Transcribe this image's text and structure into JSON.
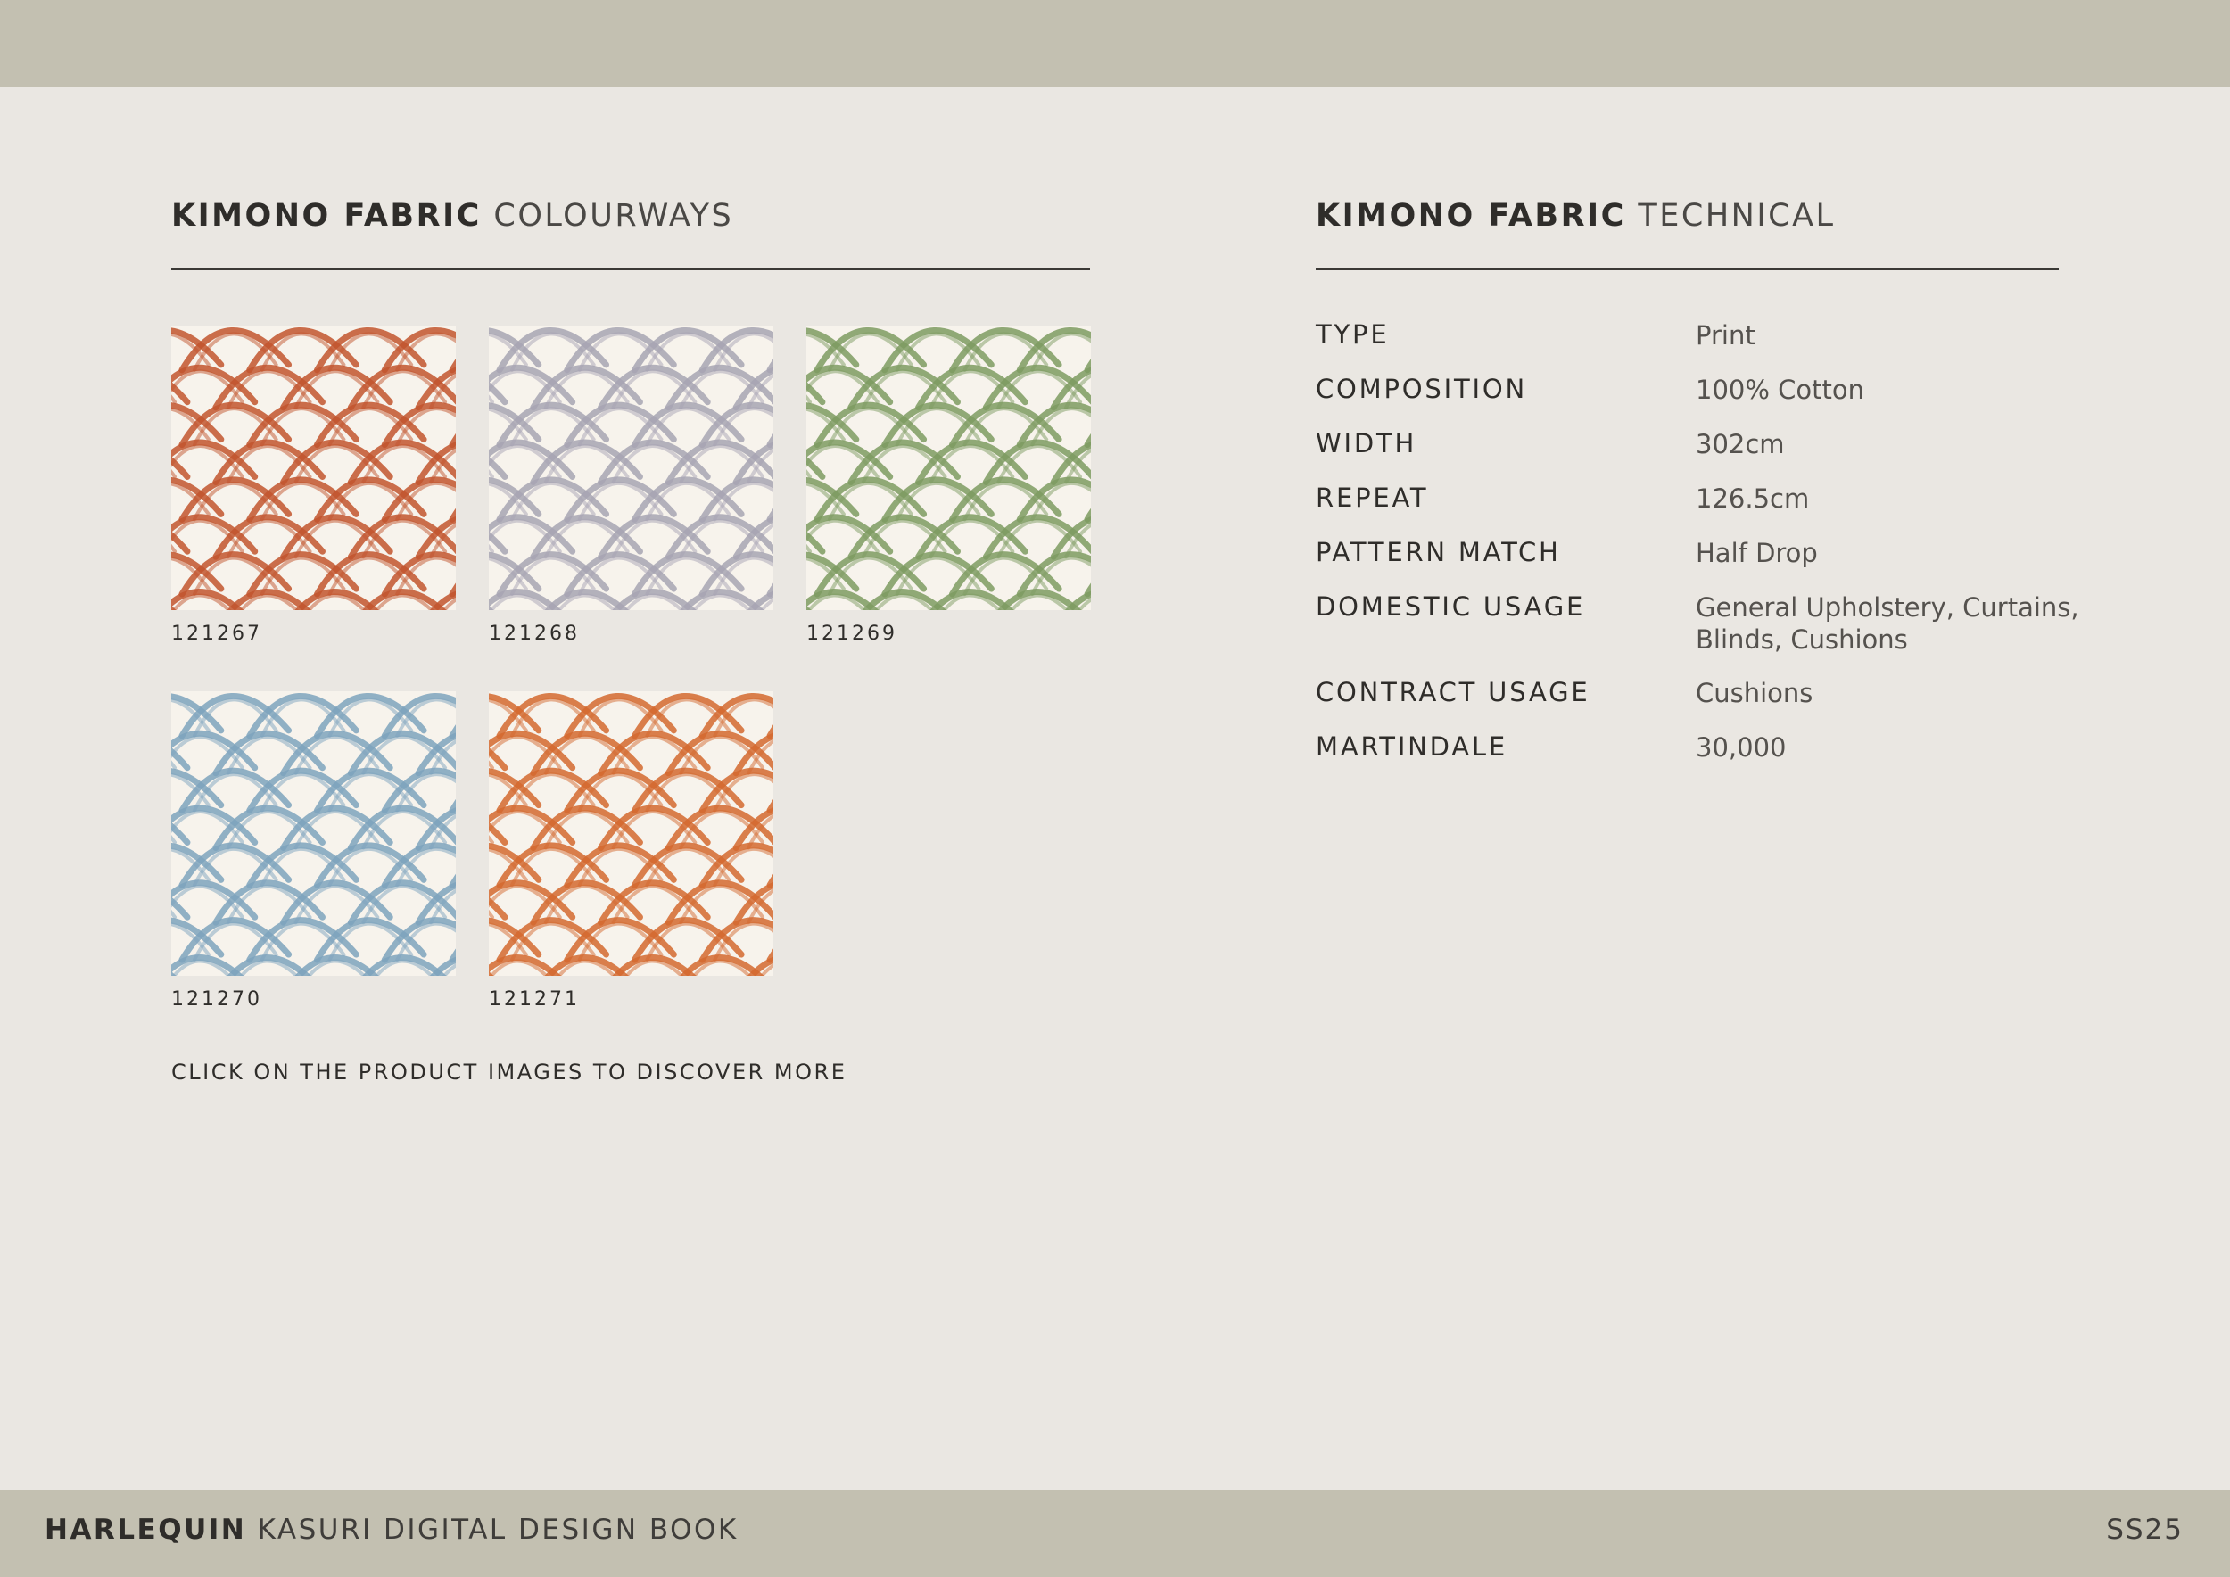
{
  "colourways": {
    "title_strong": "KIMONO FABRIC",
    "title_light": "COLOURWAYS",
    "swatches": [
      {
        "code": "121267",
        "color": "#c2552e"
      },
      {
        "code": "121268",
        "color": "#a7a4b3"
      },
      {
        "code": "121269",
        "color": "#7e9b62"
      },
      {
        "code": "121270",
        "color": "#7ea3bd"
      },
      {
        "code": "121271",
        "color": "#d4692f"
      }
    ],
    "cta": "CLICK ON THE PRODUCT IMAGES TO DISCOVER MORE"
  },
  "technical": {
    "title_strong": "KIMONO FABRIC",
    "title_light": "TECHNICAL",
    "rows": [
      {
        "label": "TYPE",
        "value": "Print"
      },
      {
        "label": "COMPOSITION",
        "value": "100% Cotton"
      },
      {
        "label": "WIDTH",
        "value": "302cm"
      },
      {
        "label": "REPEAT",
        "value": "126.5cm"
      },
      {
        "label": "PATTERN MATCH",
        "value": "Half Drop"
      },
      {
        "label": "DOMESTIC USAGE",
        "value": "General Upholstery, Curtains, Blinds, Cushions"
      },
      {
        "label": "CONTRACT USAGE",
        "value": "Cushions"
      },
      {
        "label": "MARTINDALE",
        "value": "30,000"
      }
    ]
  },
  "footer": {
    "brand_strong": "HARLEQUIN",
    "brand_light": "KASURI DIGITAL DESIGN BOOK",
    "season": "SS25"
  },
  "colors": {
    "band": "#c3c0b1",
    "page": "#eae7e2",
    "text": "#2f2d2a"
  }
}
